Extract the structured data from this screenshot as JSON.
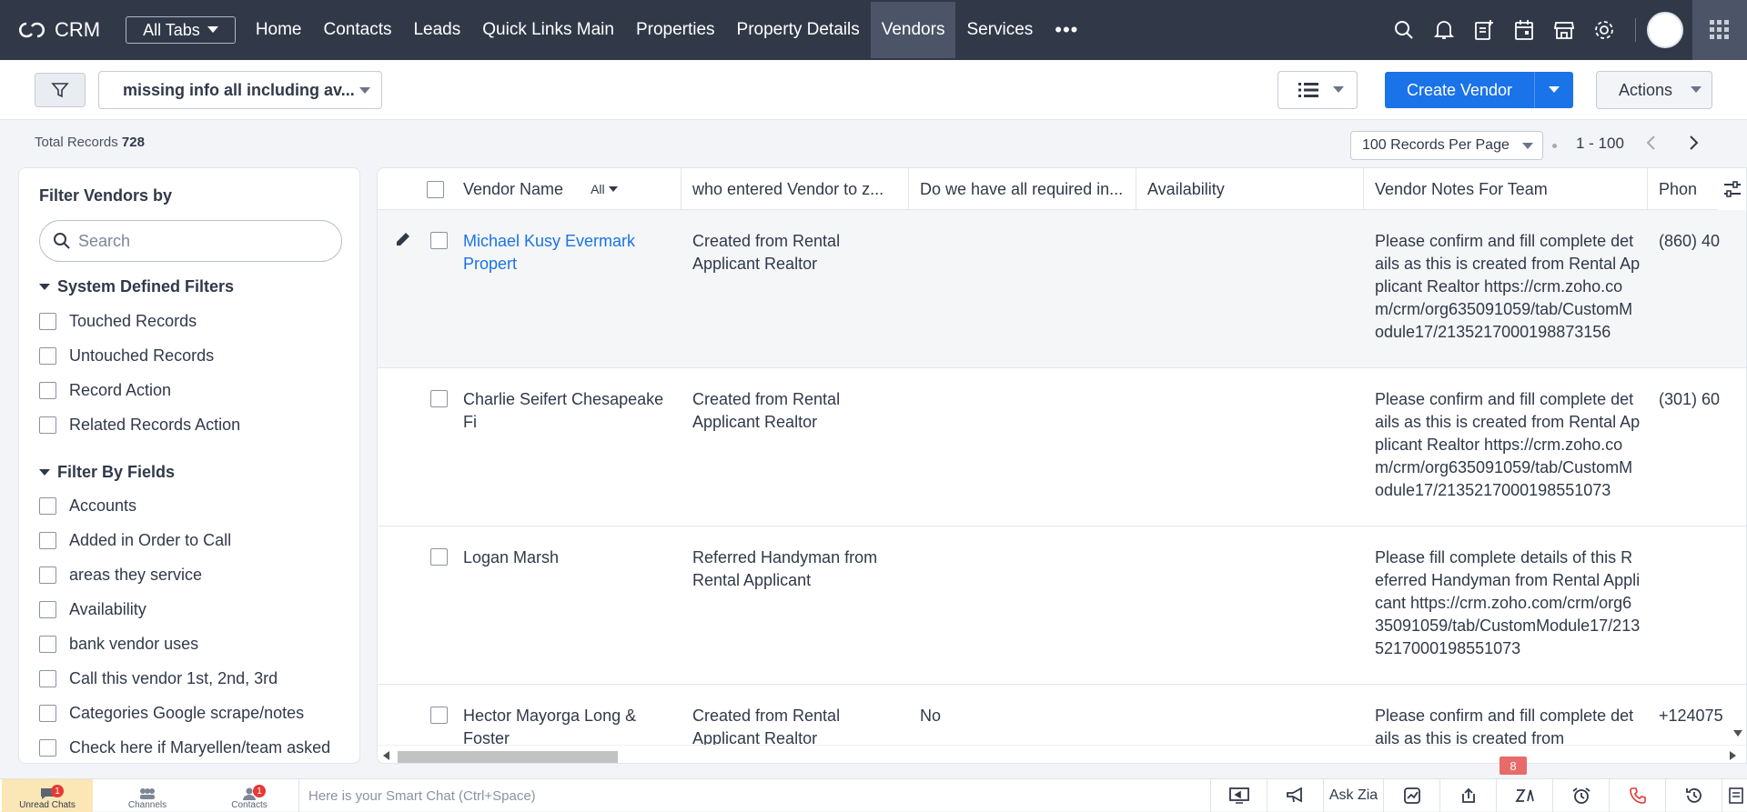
{
  "app": {
    "name": "CRM"
  },
  "nav": {
    "all_tabs": "All Tabs",
    "tabs": [
      "Home",
      "Contacts",
      "Leads",
      "Quick Links Main",
      "Properties",
      "Property Details",
      "Vendors",
      "Services"
    ],
    "more": "•••"
  },
  "toolbar": {
    "view": "missing info all including av...",
    "create_label": "Create Vendor",
    "actions_label": "Actions"
  },
  "records": {
    "total_label": "Total Records",
    "total": "728",
    "per_page": "100 Records Per Page",
    "range": "1 - 100"
  },
  "sidebar": {
    "title": "Filter Vendors by",
    "search_placeholder": "Search",
    "system_section": "System Defined Filters",
    "system_filters": [
      "Touched Records",
      "Untouched Records",
      "Record Action",
      "Related Records Action"
    ],
    "fields_section": "Filter By Fields",
    "field_filters": [
      "Accounts",
      "Added in Order to Call",
      "areas they service",
      "Availability",
      "bank vendor uses",
      "Call this vendor 1st, 2nd, 3rd",
      "Categories Google scrape/notes",
      "Check here if Maryellen/team asked"
    ]
  },
  "table": {
    "columns": {
      "vendor_name": "Vendor Name",
      "all_badge": "All",
      "who_entered": "who entered Vendor to z...",
      "required_info": "Do we have all required in...",
      "availability": "Availability",
      "notes": "Vendor Notes For Team",
      "phone": "Phon"
    },
    "rows": [
      {
        "name": "Michael Kusy Evermark Propert",
        "who": "Created from Rental Applicant Realtor",
        "required": "",
        "availability": "",
        "notes": "Please confirm and fill complete details as this is created from Rental Applicant Realtor https://crm.zoho.com/crm/org635091059/tab/CustomModule17/2135217000198873156",
        "phone": "(860) 40"
      },
      {
        "name": "Charlie Seifert Chesapeake Fi",
        "who": "Created from Rental Applicant Realtor",
        "required": "",
        "availability": "",
        "notes": "Please confirm and fill complete details as this is created from Rental Applicant Realtor https://crm.zoho.com/crm/org635091059/tab/CustomModule17/2135217000198551073",
        "phone": "(301) 60"
      },
      {
        "name": "Logan Marsh",
        "who": "Referred Handyman from Rental Applicant",
        "required": "",
        "availability": "",
        "notes": "Please fill complete details of this Referred Handyman from Rental Applicant https://crm.zoho.com/crm/org635091059/tab/CustomModule17/2135217000198551073",
        "phone": ""
      },
      {
        "name": "Hector Mayorga Long & Foster",
        "who": "Created from Rental Applicant Realtor",
        "required": "No",
        "availability": "",
        "notes": "Please confirm and fill complete details as this is created from",
        "phone": "+124075"
      }
    ]
  },
  "bottom": {
    "tabs": [
      {
        "label": "Unread Chats",
        "badge": "1"
      },
      {
        "label": "Channels",
        "badge": ""
      },
      {
        "label": "Contacts",
        "badge": "1"
      }
    ],
    "smart_chat_placeholder": "Here is your Smart Chat (Ctrl+Space)",
    "ask_zia": "Ask Zia",
    "notification_count": "8"
  },
  "colors": {
    "nav_bg": "#313949",
    "accent": "#1a73e8",
    "link": "#1a73e8"
  }
}
